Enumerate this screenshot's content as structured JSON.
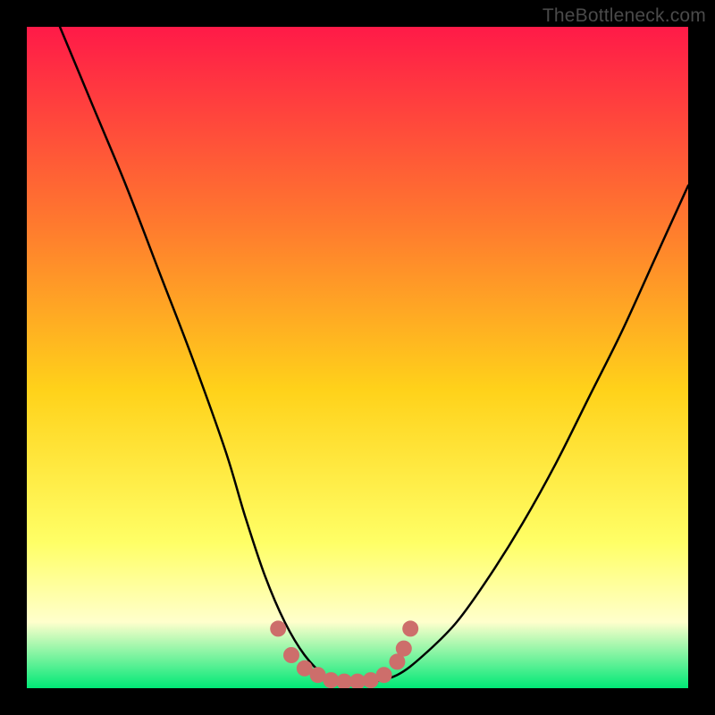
{
  "watermark": "TheBottleneck.com",
  "colors": {
    "black": "#000000",
    "curve": "#000000",
    "marker": "#cd6e6b",
    "grad_top": "#ff1a48",
    "grad_mid1": "#ff7a2e",
    "grad_mid2": "#ffd21a",
    "grad_low1": "#ffff66",
    "grad_low2": "#ffffcc",
    "grad_bottom": "#00e876"
  },
  "chart_data": {
    "type": "line",
    "title": "",
    "xlabel": "",
    "ylabel": "",
    "xlim": [
      0,
      100
    ],
    "ylim": [
      0,
      100
    ],
    "series": [
      {
        "name": "bottleneck-curve",
        "x": [
          5,
          10,
          15,
          20,
          25,
          30,
          33,
          36,
          39,
          42,
          45,
          48,
          52,
          56,
          60,
          65,
          70,
          75,
          80,
          85,
          90,
          95,
          100
        ],
        "y": [
          100,
          88,
          76,
          63,
          50,
          36,
          26,
          17,
          10,
          5,
          2,
          1,
          1,
          2,
          5,
          10,
          17,
          25,
          34,
          44,
          54,
          65,
          76
        ]
      }
    ],
    "markers": {
      "name": "highlight-band",
      "x": [
        38,
        40,
        42,
        44,
        46,
        48,
        50,
        52,
        54,
        56,
        57,
        58
      ],
      "y": [
        9,
        5,
        3,
        2,
        1.2,
        1,
        1,
        1.2,
        2,
        4,
        6,
        9
      ]
    }
  }
}
